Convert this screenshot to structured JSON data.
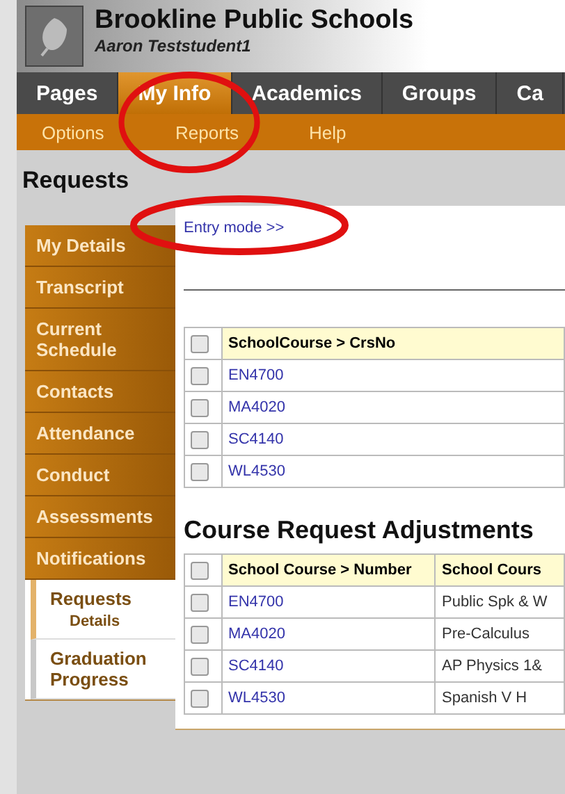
{
  "header": {
    "title": "Brookline Public Schools",
    "user": "Aaron Teststudent1"
  },
  "nav_tabs": [
    {
      "label": "Pages",
      "selected": false
    },
    {
      "label": "My Info",
      "selected": true
    },
    {
      "label": "Academics",
      "selected": false
    },
    {
      "label": "Groups",
      "selected": false
    },
    {
      "label": "Ca",
      "selected": false
    }
  ],
  "sub_menu": [
    "Options",
    "Reports",
    "Help"
  ],
  "page_title": "Requests",
  "sidebar": {
    "items": [
      {
        "label": "My Details",
        "selected": false,
        "kind": "dark"
      },
      {
        "label": "Transcript",
        "selected": false,
        "kind": "dark"
      },
      {
        "label": "Current Schedule",
        "selected": false,
        "kind": "dark"
      },
      {
        "label": "Contacts",
        "selected": false,
        "kind": "dark"
      },
      {
        "label": "Attendance",
        "selected": false,
        "kind": "dark"
      },
      {
        "label": "Conduct",
        "selected": false,
        "kind": "dark"
      },
      {
        "label": "Assessments",
        "selected": false,
        "kind": "dark"
      },
      {
        "label": "Notifications",
        "selected": false,
        "kind": "dark"
      },
      {
        "label": "Requests",
        "selected": true,
        "kind": "light",
        "children": [
          {
            "label": "Details"
          }
        ]
      },
      {
        "label": "Graduation Progress",
        "selected": false,
        "kind": "light"
      }
    ]
  },
  "entry_mode_link": "Entry mode >>",
  "requests_table": {
    "all_checked": false,
    "columns": [
      "SchoolCourse > CrsNo"
    ],
    "rows": [
      {
        "checked": false,
        "cells": [
          "EN4700"
        ]
      },
      {
        "checked": false,
        "cells": [
          "MA4020"
        ]
      },
      {
        "checked": false,
        "cells": [
          "SC4140"
        ]
      },
      {
        "checked": false,
        "cells": [
          "WL4530"
        ]
      }
    ]
  },
  "adjustments": {
    "title": "Course Request Adjustments",
    "all_checked": false,
    "columns": [
      "School Course > Number",
      "School Cours"
    ],
    "rows": [
      {
        "checked": false,
        "cells": [
          "EN4700",
          "Public Spk & W"
        ]
      },
      {
        "checked": false,
        "cells": [
          "MA4020",
          "Pre-Calculus"
        ]
      },
      {
        "checked": false,
        "cells": [
          "SC4140",
          "AP Physics 1&"
        ]
      },
      {
        "checked": false,
        "cells": [
          "WL4530",
          "Spanish V H"
        ]
      }
    ]
  }
}
